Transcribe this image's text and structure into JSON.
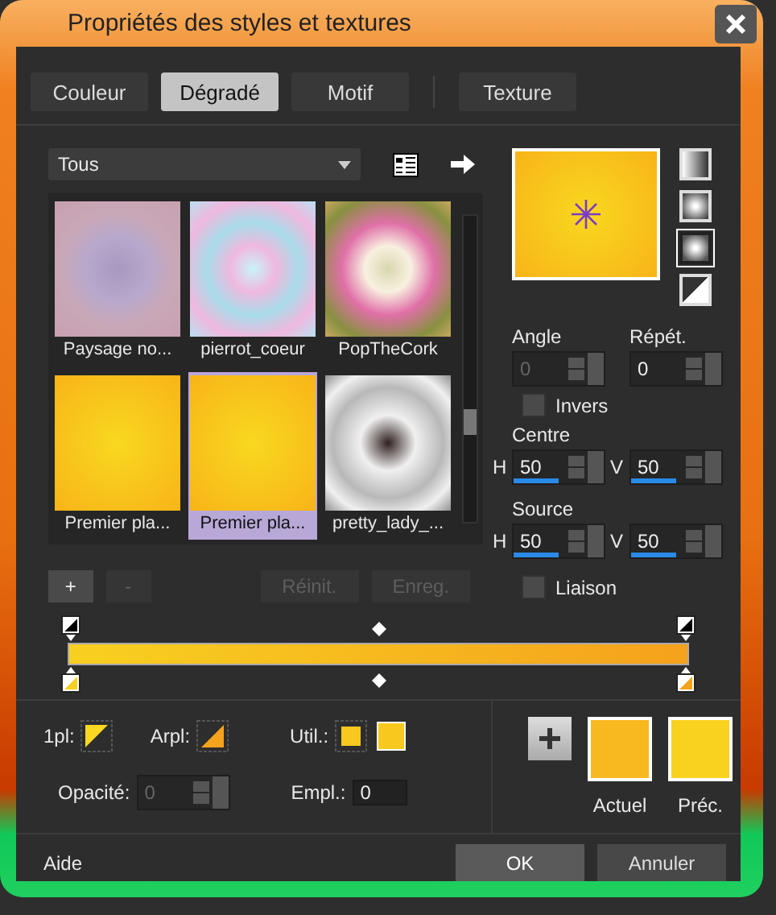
{
  "window": {
    "title": "Propriétés des styles et textures"
  },
  "tabs": [
    {
      "label": "Couleur",
      "selected": false
    },
    {
      "label": "Dégradé",
      "selected": true
    },
    {
      "label": "Motif",
      "selected": false
    },
    {
      "label": "Texture",
      "selected": false
    }
  ],
  "category_dropdown": {
    "value": "Tous"
  },
  "gradients": [
    {
      "name": "Paysage no...",
      "selected": false
    },
    {
      "name": "pierrot_coeur",
      "selected": false
    },
    {
      "name": "PopTheCork",
      "selected": false
    },
    {
      "name": "Premier pla...",
      "selected": false
    },
    {
      "name": "Premier pla...",
      "selected": true
    },
    {
      "name": "pretty_lady_...",
      "selected": false
    }
  ],
  "list_buttons": [
    {
      "label": "+",
      "disabled": false
    },
    {
      "label": "-",
      "disabled": true
    },
    {
      "label": "Réinit.",
      "disabled": true
    },
    {
      "label": "Enreg.",
      "disabled": true
    }
  ],
  "style_buttons": [
    {
      "selected": false
    },
    {
      "selected": false
    },
    {
      "selected": true
    },
    {
      "selected": false
    }
  ],
  "angle": {
    "label": "Angle",
    "value": "0",
    "disabled": true
  },
  "repeat": {
    "label": "Répét.",
    "value": "0",
    "disabled": false
  },
  "invert": {
    "label": "Invers",
    "checked": false
  },
  "centre": {
    "label": "Centre",
    "fields": [
      {
        "label": "H",
        "value": "50",
        "level": 0.5
      },
      {
        "label": "V",
        "value": "50",
        "level": 0.5
      }
    ]
  },
  "source": {
    "label": "Source",
    "fields": [
      {
        "label": "H",
        "value": "50",
        "level": 0.5
      },
      {
        "label": "V",
        "value": "50",
        "level": 0.5
      }
    ]
  },
  "link": {
    "label": "Liaison",
    "checked": false
  },
  "stop_labels": [
    "1pl:",
    "Arpl:",
    "Util.:"
  ],
  "opacity": {
    "label": "Opacité:",
    "value": "0",
    "disabled": true
  },
  "position": {
    "label": "Empl.:",
    "value": "0"
  },
  "swatches": [
    {
      "label": "Actuel",
      "color": "#f8b820"
    },
    {
      "label": "Préc.",
      "color": "#f8d21e"
    }
  ],
  "footer": {
    "help": "Aide",
    "ok": "OK",
    "cancel": "Annuler"
  }
}
